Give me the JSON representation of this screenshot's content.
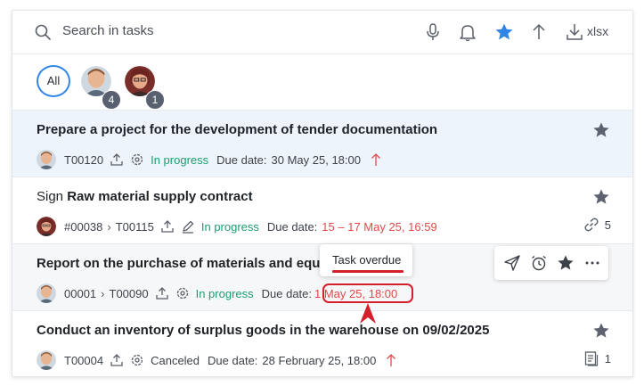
{
  "toolbar": {
    "search_placeholder": "Search in tasks",
    "export_label": "xlsx",
    "icons": [
      "search-icon",
      "microphone-icon",
      "bell-icon",
      "star-icon",
      "sort-up-icon",
      "download-icon"
    ],
    "accent_color": "#2f86e6"
  },
  "filters": {
    "all_label": "All",
    "avatars": [
      {
        "badge": "4"
      },
      {
        "badge": "1"
      }
    ]
  },
  "tasks": [
    {
      "title": "Prepare a project for the development of tender documentation",
      "code": "T00120",
      "status": "In progress",
      "due_label": "Due date:",
      "due_value": "30 May 25, 18:00"
    },
    {
      "title_prefix": "Sign ",
      "title_bold": "Raw material supply contract",
      "parent_code": "#00038",
      "code": "T00115",
      "status": "In progress",
      "due_label": "Due date:",
      "due_value": "15 – 17 May 25, 16:59",
      "link_count": "5"
    },
    {
      "title": "Report on the purchase of materials and equip",
      "parent_code": "00001",
      "code": "T00090",
      "status": "In progress",
      "due_label": "Due date:",
      "due_value": "1 May 25, 18:00",
      "tooltip": "Task overdue"
    },
    {
      "title": "Conduct an inventory of surplus goods in the warehouse on 09/02/2025",
      "code": "T00004",
      "status": "Canceled",
      "due_label": "Due date:",
      "due_value": "28 February 25, 18:00",
      "doc_count": "1"
    }
  ],
  "colors": {
    "in_progress": "#1e9e6e",
    "overdue": "#e24a4a",
    "highlight": "#d4202a",
    "selected_row": "#edf4fb"
  }
}
